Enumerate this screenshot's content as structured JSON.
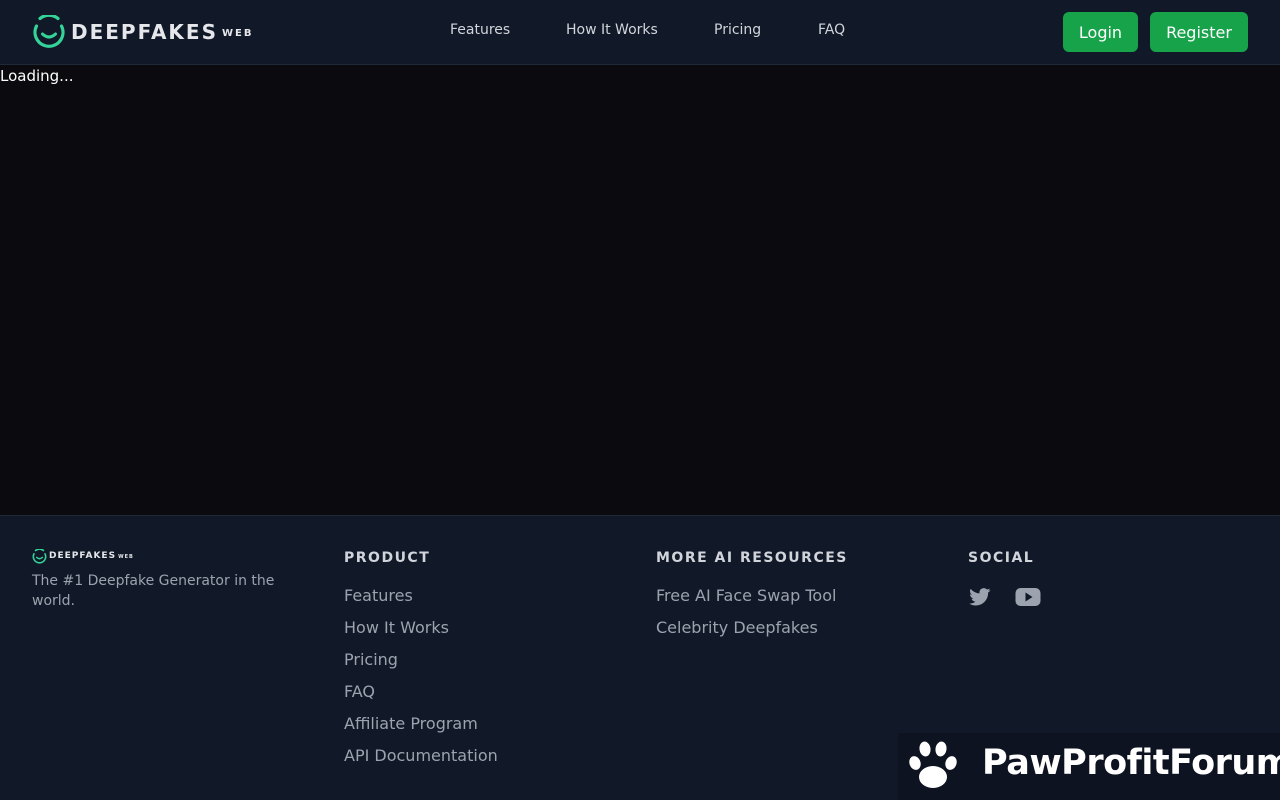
{
  "brand": {
    "name": "DEEPFAKES",
    "suffix": "WEB",
    "accent_color": "#34d399"
  },
  "nav": {
    "items": [
      {
        "label": "Features"
      },
      {
        "label": "How It Works"
      },
      {
        "label": "Pricing"
      },
      {
        "label": "FAQ"
      }
    ]
  },
  "auth": {
    "login_label": "Login",
    "register_label": "Register",
    "button_color": "#16a34a"
  },
  "main": {
    "status_text": "Loading..."
  },
  "footer": {
    "tagline": "The #1 Deepfake Generator in the world.",
    "product": {
      "title": "PRODUCT",
      "links": [
        "Features",
        "How It Works",
        "Pricing",
        "FAQ",
        "Affiliate Program",
        "API Documentation"
      ]
    },
    "resources": {
      "title": "MORE AI RESOURCES",
      "links": [
        "Free AI Face Swap Tool",
        "Celebrity Deepfakes"
      ]
    },
    "social": {
      "title": "SOCIAL",
      "icons": [
        "twitter-icon",
        "youtube-icon"
      ]
    }
  },
  "watermark": {
    "text": "PawProfitForum",
    "icon": "paw-icon"
  }
}
